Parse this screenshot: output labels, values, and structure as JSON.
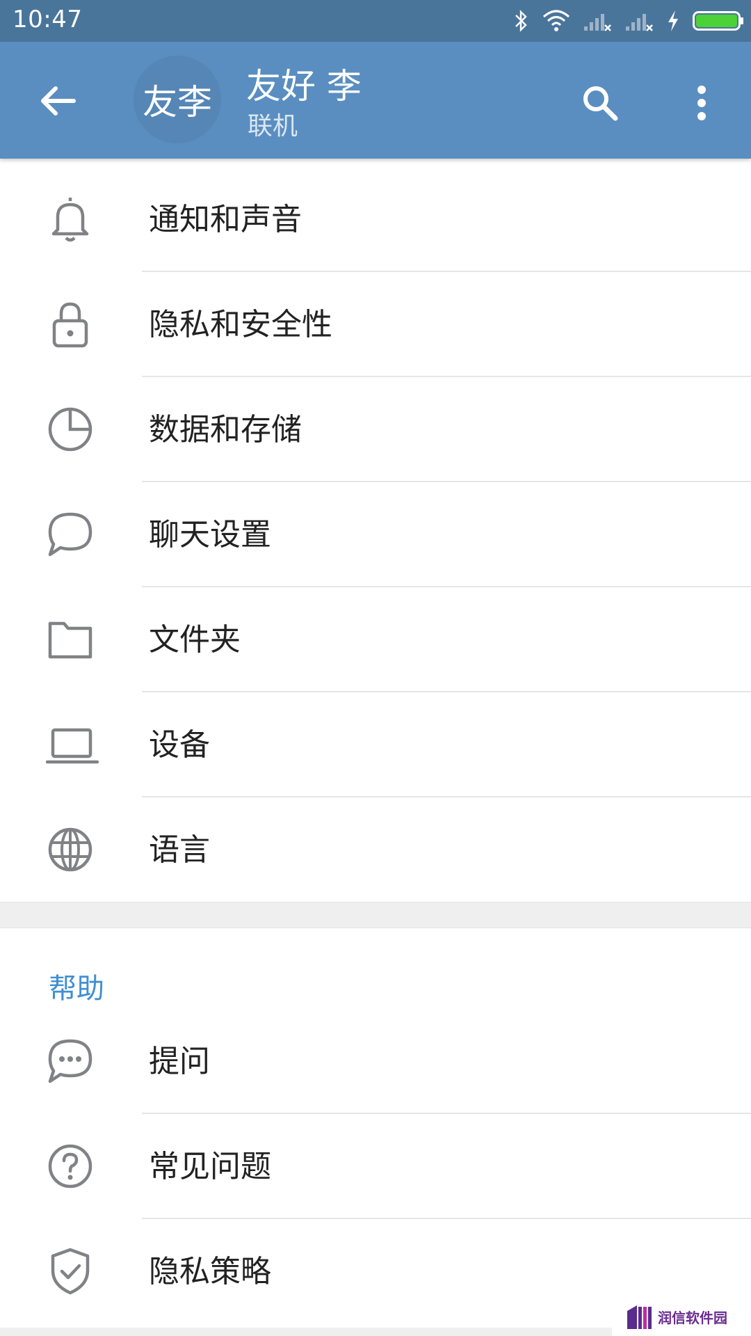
{
  "status_bar": {
    "time": "10:47"
  },
  "header": {
    "avatar_initials": "友李",
    "name": "友好 李",
    "status": "联机"
  },
  "settings_items": [
    {
      "label": "通知和声音",
      "icon": "bell-icon"
    },
    {
      "label": "隐私和安全性",
      "icon": "lock-icon"
    },
    {
      "label": "数据和存储",
      "icon": "pie-chart-icon"
    },
    {
      "label": "聊天设置",
      "icon": "chat-bubble-icon"
    },
    {
      "label": "文件夹",
      "icon": "folder-icon"
    },
    {
      "label": "设备",
      "icon": "laptop-icon"
    },
    {
      "label": "语言",
      "icon": "globe-icon"
    }
  ],
  "help_section": {
    "title": "帮助",
    "items": [
      {
        "label": "提问",
        "icon": "chat-dots-icon"
      },
      {
        "label": "常见问题",
        "icon": "question-circle-icon"
      },
      {
        "label": "隐私策略",
        "icon": "shield-check-icon"
      }
    ]
  },
  "watermark": {
    "text": "润信软件园"
  },
  "colors": {
    "status_bar": "#4a759b",
    "app_bar": "#5a8ec0",
    "accent": "#3f8fd2",
    "icon_gray": "#808285",
    "battery": "#4cd137"
  }
}
